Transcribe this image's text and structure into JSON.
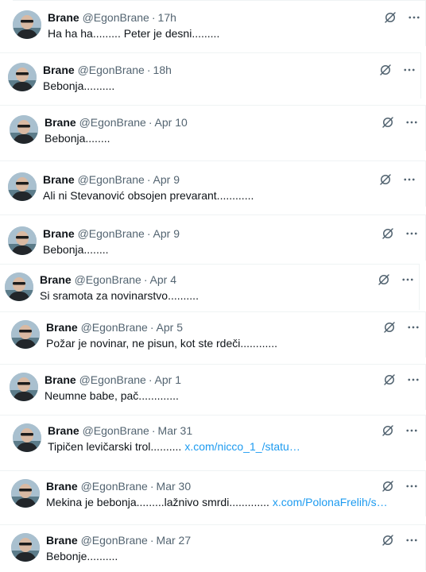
{
  "author": {
    "name": "Brane",
    "handle": "@EgonBrane"
  },
  "icons": {
    "grok": "grok-icon",
    "more": "more-icon"
  },
  "colors": {
    "link": "#1d9bf0",
    "secondary": "#536471",
    "text": "#0f1419"
  },
  "tweets": [
    {
      "time": "17h",
      "text": "Ha ha ha......... Peter je desni........."
    },
    {
      "time": "18h",
      "text": "Bebonja.........."
    },
    {
      "time": "Apr 10",
      "text": "Bebonja........"
    },
    {
      "time": "Apr 9",
      "text": "Ali ni Stevanović obsojen prevarant............"
    },
    {
      "time": "Apr 9",
      "text": "Bebonja........"
    },
    {
      "time": "Apr 4",
      "text": "Si sramota za novinarstvo.........."
    },
    {
      "time": "Apr 5",
      "text": "Požar je novinar, ne pisun, kot ste rdeči............"
    },
    {
      "time": "Apr 1",
      "text": "Neumne babe, pač............."
    },
    {
      "time": "Mar 31",
      "text": "Tipičen levičarski trol..........",
      "link": "x.com/nicco_1_/statu…"
    },
    {
      "time": "Mar 30",
      "text": "Mekina je bebonja.........lažnivo smrdi.............",
      "link": "x.com/PolonaFrelih/s…"
    },
    {
      "time": "Mar 27",
      "text": "Bebonje.........."
    }
  ]
}
